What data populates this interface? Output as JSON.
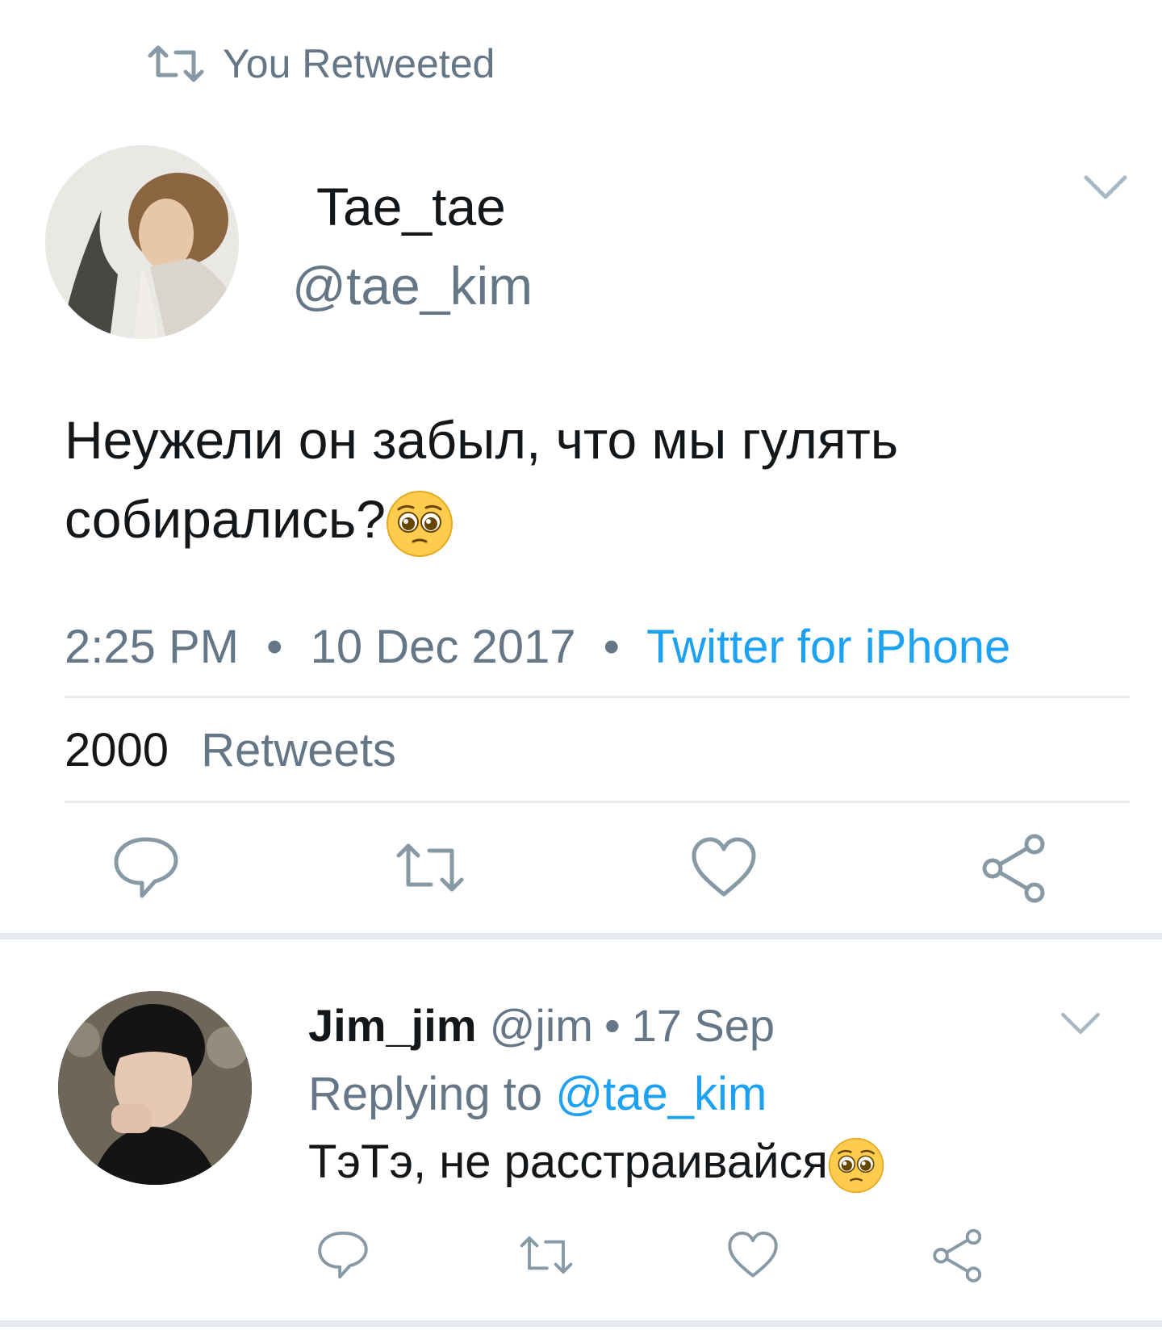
{
  "retweet_header": {
    "text": "You Retweeted",
    "icon": "retweet-icon"
  },
  "tweet": {
    "author_name": "Tae_tae",
    "author_handle": "@tae_kim",
    "text": "Неужели он забыл, что мы гулять собирались?",
    "emoji": "pleading-face",
    "time": "2:25 PM",
    "date": "10 Dec 2017",
    "source": "Twitter for iPhone",
    "separator": "•",
    "stats": {
      "retweet_count": "2000",
      "retweet_label": "Retweets"
    },
    "actions": [
      "reply-icon",
      "retweet-icon",
      "like-icon",
      "share-icon"
    ]
  },
  "reply": {
    "author_name": "Jim_jim",
    "author_handle": "@jim",
    "separator": "•",
    "date": "17 Sep",
    "replying_label": "Replying to",
    "replying_handle": "@tae_kim",
    "text": "ТэТэ, не расстраивайся",
    "emoji": "pleading-face",
    "actions": [
      "reply-icon",
      "retweet-icon",
      "like-icon",
      "share-icon"
    ]
  },
  "colors": {
    "text": "#14171a",
    "secondary": "#657786",
    "link": "#1da1f2",
    "divider": "#e6ecf0",
    "icon": "#8899a6"
  }
}
